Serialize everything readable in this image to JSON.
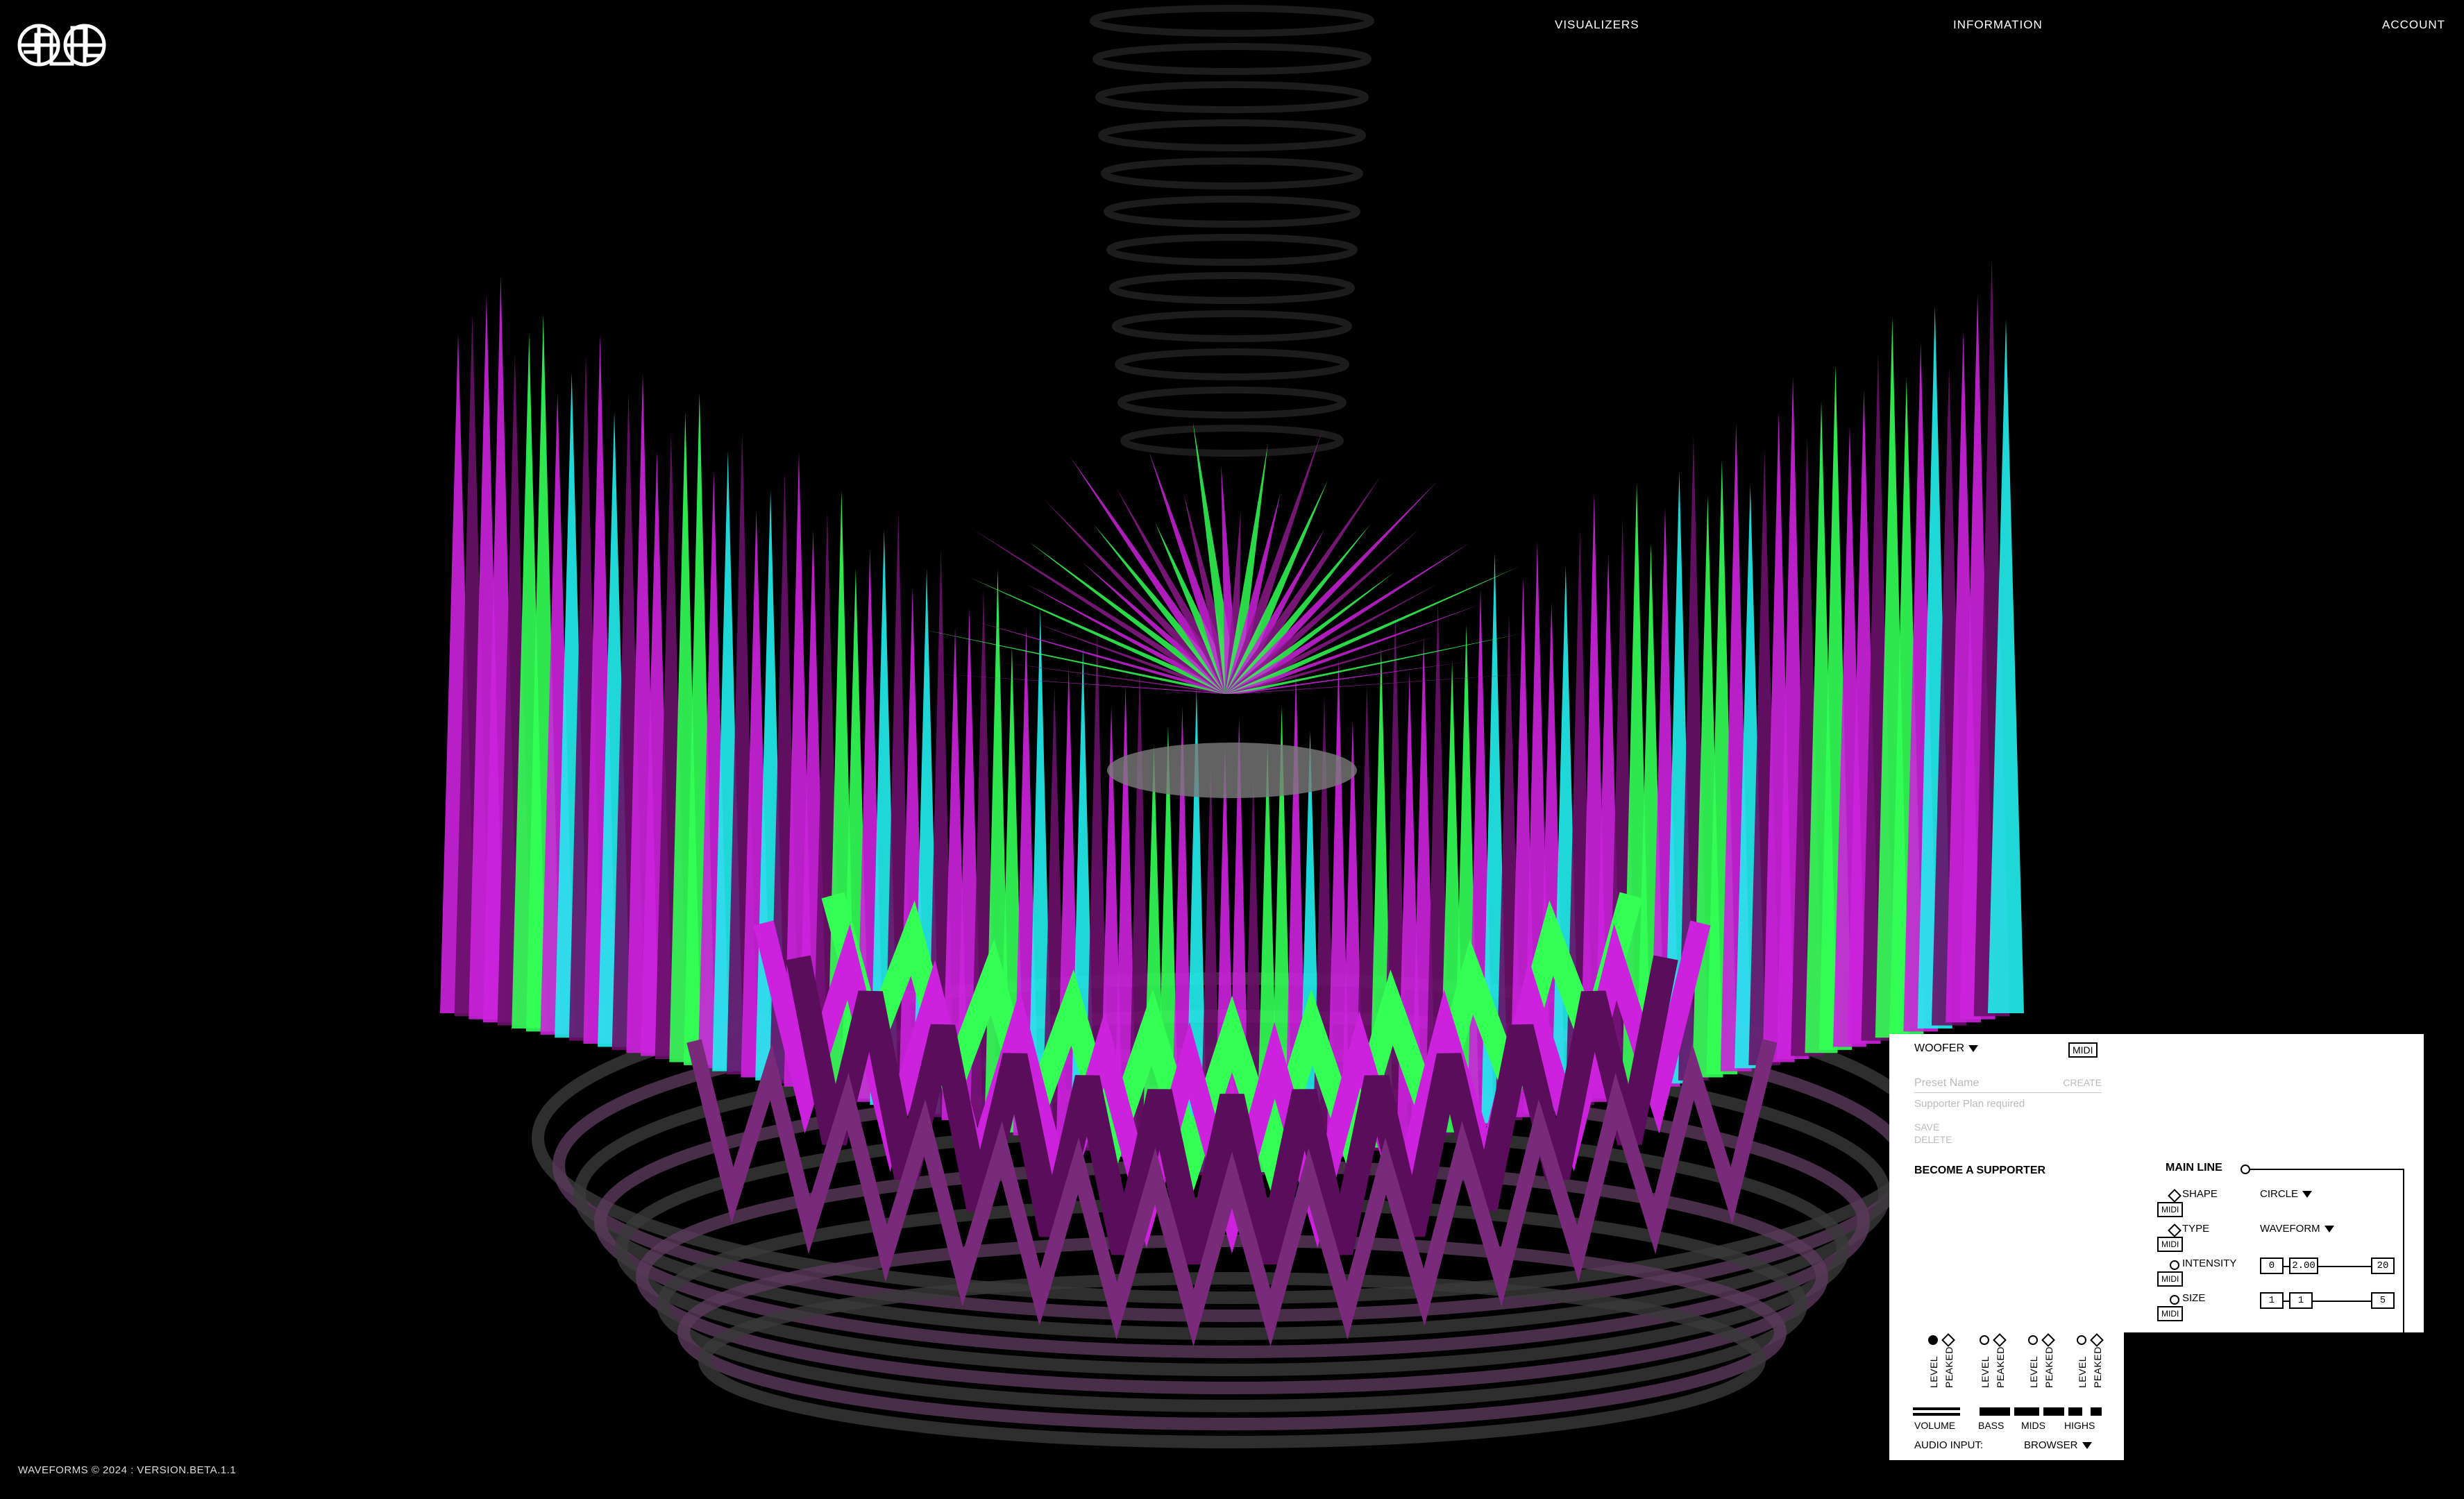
{
  "app": {
    "name": "WAVEFORMS",
    "footer": "WAVEFORMS © 2024 : VERSION.BETA.1.1"
  },
  "nav": {
    "items": [
      "VISUALIZERS",
      "INFORMATION",
      "ACCOUNT"
    ]
  },
  "icons": {
    "logo": "globe-waveform-logo",
    "dropdown": "caret-down-icon",
    "toggle": "diamond-toggle-icon"
  },
  "colors": {
    "magenta": "#cc22dd",
    "green": "#33ff55",
    "cyan": "#22eeee",
    "purple": "#6a0f6a",
    "panel_bg": "#ffffff"
  },
  "panel": {
    "preset_dropdown": "WOOFER",
    "midi_label": "MIDI",
    "preset_name_placeholder": "Preset Name",
    "create_label": "CREATE",
    "supporter_note": "Supporter Plan required",
    "save_label": "SAVE",
    "delete_label": "DELETE",
    "become_supporter": "BECOME A SUPPORTER",
    "section_title": "MAIN LINE",
    "controls": [
      {
        "label": "SHAPE",
        "value": "CIRCLE"
      },
      {
        "label": "TYPE",
        "value": "WAVEFORM"
      },
      {
        "label": "INTENSITY",
        "min": "0",
        "value": "2.00",
        "max": "20"
      },
      {
        "label": "SIZE",
        "min": "1",
        "value": "1",
        "max": "5"
      }
    ]
  },
  "audio": {
    "meter_labels": [
      "LEVEL",
      "PEAKED"
    ],
    "bands": [
      "VOLUME",
      "BASS",
      "MIDS",
      "HIGHS"
    ],
    "input_label": "AUDIO INPUT:",
    "input_value": "BROWSER"
  }
}
